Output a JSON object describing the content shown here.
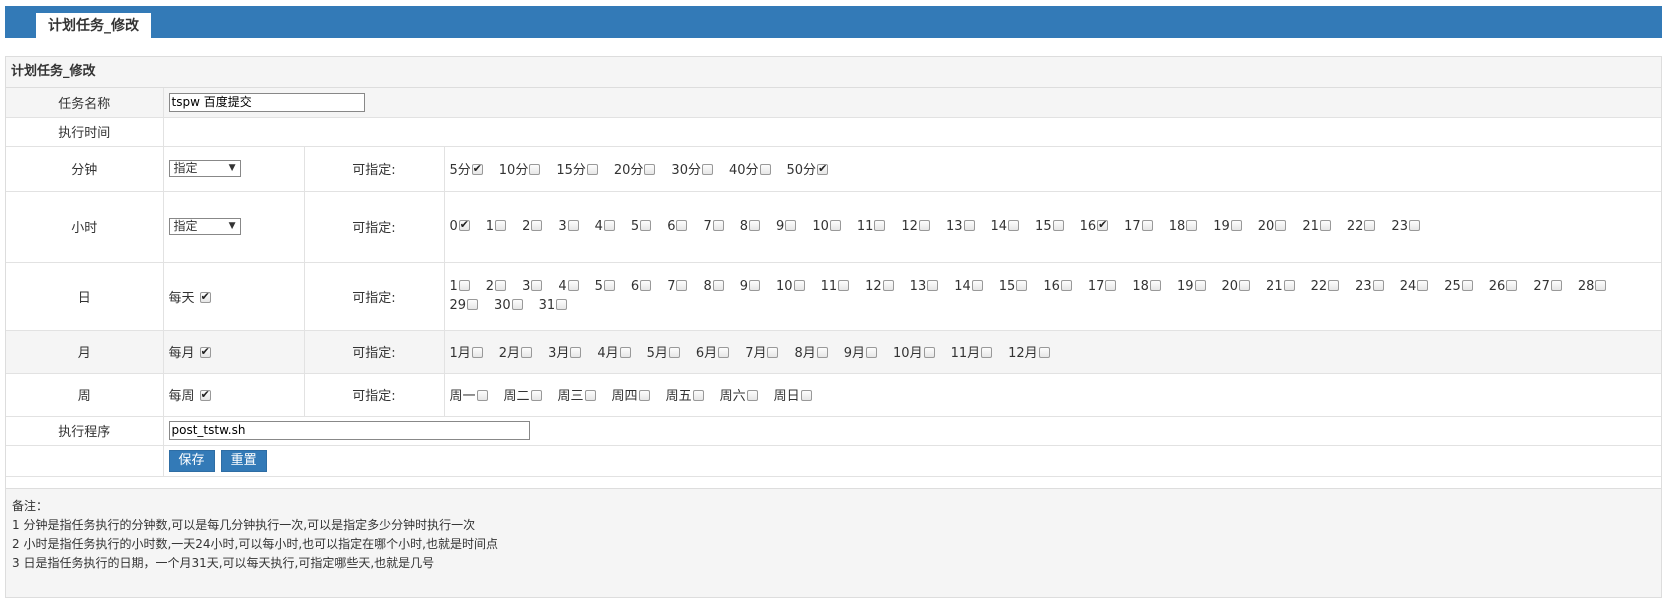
{
  "header": {
    "tab_label": "计划任务_修改"
  },
  "panel": {
    "title": "计划任务_修改"
  },
  "form": {
    "task_name_label": "任务名称",
    "task_name_value": "tspw 百度提交",
    "exec_time_label": "执行时间",
    "minute": {
      "label": "分钟",
      "mode": "指定",
      "assign_label": "可指定:",
      "options": [
        {
          "label": "5分",
          "checked": true
        },
        {
          "label": "10分",
          "checked": false
        },
        {
          "label": "15分",
          "checked": false
        },
        {
          "label": "20分",
          "checked": false
        },
        {
          "label": "30分",
          "checked": false
        },
        {
          "label": "40分",
          "checked": false
        },
        {
          "label": "50分",
          "checked": true
        }
      ]
    },
    "hour": {
      "label": "小时",
      "mode": "指定",
      "assign_label": "可指定:",
      "options": [
        {
          "label": "0",
          "checked": true
        },
        {
          "label": "1",
          "checked": false
        },
        {
          "label": "2",
          "checked": false
        },
        {
          "label": "3",
          "checked": false
        },
        {
          "label": "4",
          "checked": false
        },
        {
          "label": "5",
          "checked": false
        },
        {
          "label": "6",
          "checked": false
        },
        {
          "label": "7",
          "checked": false
        },
        {
          "label": "8",
          "checked": false
        },
        {
          "label": "9",
          "checked": false
        },
        {
          "label": "10",
          "checked": false
        },
        {
          "label": "11",
          "checked": false
        },
        {
          "label": "12",
          "checked": false
        },
        {
          "label": "13",
          "checked": false
        },
        {
          "label": "14",
          "checked": false
        },
        {
          "label": "15",
          "checked": false
        },
        {
          "label": "16",
          "checked": true
        },
        {
          "label": "17",
          "checked": false
        },
        {
          "label": "18",
          "checked": false
        },
        {
          "label": "19",
          "checked": false
        },
        {
          "label": "20",
          "checked": false
        },
        {
          "label": "21",
          "checked": false
        },
        {
          "label": "22",
          "checked": false
        },
        {
          "label": "23",
          "checked": false
        }
      ]
    },
    "day": {
      "label": "日",
      "every_label": "每天",
      "every_checked": true,
      "assign_label": "可指定:",
      "options": [
        {
          "label": "1",
          "checked": false
        },
        {
          "label": "2",
          "checked": false
        },
        {
          "label": "3",
          "checked": false
        },
        {
          "label": "4",
          "checked": false
        },
        {
          "label": "5",
          "checked": false
        },
        {
          "label": "6",
          "checked": false
        },
        {
          "label": "7",
          "checked": false
        },
        {
          "label": "8",
          "checked": false
        },
        {
          "label": "9",
          "checked": false
        },
        {
          "label": "10",
          "checked": false
        },
        {
          "label": "11",
          "checked": false
        },
        {
          "label": "12",
          "checked": false
        },
        {
          "label": "13",
          "checked": false
        },
        {
          "label": "14",
          "checked": false
        },
        {
          "label": "15",
          "checked": false
        },
        {
          "label": "16",
          "checked": false
        },
        {
          "label": "17",
          "checked": false
        },
        {
          "label": "18",
          "checked": false
        },
        {
          "label": "19",
          "checked": false
        },
        {
          "label": "20",
          "checked": false
        },
        {
          "label": "21",
          "checked": false
        },
        {
          "label": "22",
          "checked": false
        },
        {
          "label": "23",
          "checked": false
        },
        {
          "label": "24",
          "checked": false
        },
        {
          "label": "25",
          "checked": false
        },
        {
          "label": "26",
          "checked": false
        },
        {
          "label": "27",
          "checked": false
        },
        {
          "label": "28",
          "checked": false
        },
        {
          "label": "29",
          "checked": false
        },
        {
          "label": "30",
          "checked": false
        },
        {
          "label": "31",
          "checked": false
        }
      ]
    },
    "month": {
      "label": "月",
      "every_label": "每月",
      "every_checked": true,
      "assign_label": "可指定:",
      "options": [
        {
          "label": "1月",
          "checked": false
        },
        {
          "label": "2月",
          "checked": false
        },
        {
          "label": "3月",
          "checked": false
        },
        {
          "label": "4月",
          "checked": false
        },
        {
          "label": "5月",
          "checked": false
        },
        {
          "label": "6月",
          "checked": false
        },
        {
          "label": "7月",
          "checked": false
        },
        {
          "label": "8月",
          "checked": false
        },
        {
          "label": "9月",
          "checked": false
        },
        {
          "label": "10月",
          "checked": false
        },
        {
          "label": "11月",
          "checked": false
        },
        {
          "label": "12月",
          "checked": false
        }
      ]
    },
    "week": {
      "label": "周",
      "every_label": "每周",
      "every_checked": true,
      "assign_label": "可指定:",
      "options": [
        {
          "label": "周一",
          "checked": false
        },
        {
          "label": "周二",
          "checked": false
        },
        {
          "label": "周三",
          "checked": false
        },
        {
          "label": "周四",
          "checked": false
        },
        {
          "label": "周五",
          "checked": false
        },
        {
          "label": "周六",
          "checked": false
        },
        {
          "label": "周日",
          "checked": false
        }
      ]
    },
    "program_label": "执行程序",
    "program_value": "post_tstw.sh",
    "save_label": "保存",
    "reset_label": "重置"
  },
  "notes": {
    "title": "备注：",
    "lines": [
      "1 分钟是指任务执行的分钟数,可以是每几分钟执行一次,可以是指定多少分钟时执行一次",
      "2 小时是指任务执行的小时数,一天24小时,可以每小时,也可以指定在哪个小时,也就是时间点",
      "3 日是指任务执行的日期，一个月31天,可以每天执行,可指定哪些天,也就是几号"
    ]
  }
}
